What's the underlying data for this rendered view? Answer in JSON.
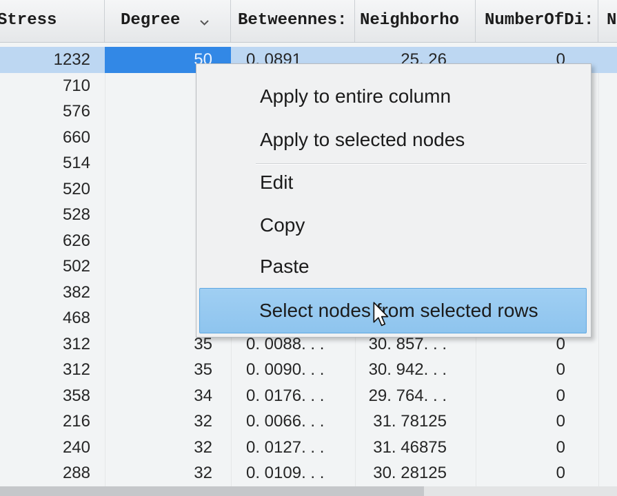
{
  "colors": {
    "accent": "#3288e6",
    "selected_row": "#bdd7f2",
    "menu_highlight": "#8ec4ee"
  },
  "table": {
    "headers": {
      "stress": "Stress",
      "degree": "Degree",
      "betweenness": "Betweennes:",
      "neighborhood": "Neighborho",
      "numberofdi": "NumberOfDi:",
      "next": "N"
    },
    "sort_icon": "chevron-down-icon",
    "rows": [
      {
        "stress": "1232",
        "degree": "50",
        "betweenness": "0. 0891",
        "neighborhood": "25. 26",
        "numberofdi": "0",
        "selected": true,
        "degree_selected": true
      },
      {
        "stress": "710"
      },
      {
        "stress": "576"
      },
      {
        "stress": "660"
      },
      {
        "stress": "514"
      },
      {
        "stress": "520"
      },
      {
        "stress": "528"
      },
      {
        "stress": "626"
      },
      {
        "stress": "502"
      },
      {
        "stress": "382"
      },
      {
        "stress": "468"
      },
      {
        "stress": "312",
        "degree": "35",
        "betweenness": "0. 0088. . .",
        "neighborhood": "30. 857. . .",
        "numberofdi": "0"
      },
      {
        "stress": "312",
        "degree": "35",
        "betweenness": "0. 0090. . .",
        "neighborhood": "30. 942. . .",
        "numberofdi": "0"
      },
      {
        "stress": "358",
        "degree": "34",
        "betweenness": "0. 0176. . .",
        "neighborhood": "29. 764. . .",
        "numberofdi": "0"
      },
      {
        "stress": "216",
        "degree": "32",
        "betweenness": "0. 0066. . .",
        "neighborhood": "31. 78125",
        "numberofdi": "0"
      },
      {
        "stress": "240",
        "degree": "32",
        "betweenness": "0. 0127. . .",
        "neighborhood": "31. 46875",
        "numberofdi": "0"
      },
      {
        "stress": "288",
        "degree": "32",
        "betweenness": "0. 0109. . .",
        "neighborhood": "30. 28125",
        "numberofdi": "0"
      }
    ]
  },
  "context_menu": {
    "items": [
      {
        "label": "Apply to entire column"
      },
      {
        "label": "Apply to selected nodes"
      },
      {
        "label": "Edit"
      },
      {
        "label": "Copy"
      },
      {
        "label": "Paste"
      },
      {
        "label": "Select nodes from selected rows",
        "highlighted": true
      }
    ]
  },
  "cursor_icon": "arrow-pointer-icon"
}
